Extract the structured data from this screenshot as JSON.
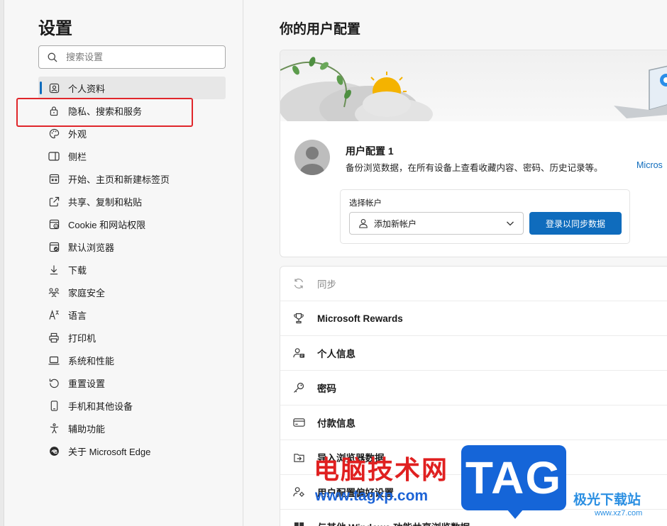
{
  "sidebar": {
    "title": "设置",
    "search_placeholder": "搜索设置",
    "items": [
      {
        "label": "个人资料",
        "icon": "profile-icon",
        "active": true
      },
      {
        "label": "隐私、搜索和服务",
        "icon": "lock-icon"
      },
      {
        "label": "外观",
        "icon": "palette-icon"
      },
      {
        "label": "侧栏",
        "icon": "sidebar-icon"
      },
      {
        "label": "开始、主页和新建标签页",
        "icon": "home-tab-icon"
      },
      {
        "label": "共享、复制和粘贴",
        "icon": "share-icon"
      },
      {
        "label": "Cookie 和网站权限",
        "icon": "cookie-icon"
      },
      {
        "label": "默认浏览器",
        "icon": "browser-icon"
      },
      {
        "label": "下载",
        "icon": "download-icon"
      },
      {
        "label": "家庭安全",
        "icon": "family-icon"
      },
      {
        "label": "语言",
        "icon": "language-icon"
      },
      {
        "label": "打印机",
        "icon": "printer-icon"
      },
      {
        "label": "系统和性能",
        "icon": "laptop-icon"
      },
      {
        "label": "重置设置",
        "icon": "reset-icon"
      },
      {
        "label": "手机和其他设备",
        "icon": "phone-icon"
      },
      {
        "label": "辅助功能",
        "icon": "accessibility-icon"
      },
      {
        "label": "关于 Microsoft Edge",
        "icon": "edge-icon"
      }
    ]
  },
  "main": {
    "title": "你的用户配置",
    "profile": {
      "name": "用户配置 1",
      "description": "备份浏览数据，在所有设备上查看收藏内容、密码、历史记录等。",
      "link": "Micros",
      "account_label": "选择帐户",
      "account_value": "添加新帐户",
      "signin_button": "登录以同步数据"
    },
    "rows": [
      {
        "label": "同步",
        "icon": "sync-icon",
        "muted": true
      },
      {
        "label": "Microsoft Rewards",
        "icon": "trophy-icon"
      },
      {
        "label": "个人信息",
        "icon": "person-card-icon"
      },
      {
        "label": "密码",
        "icon": "key-icon"
      },
      {
        "label": "付款信息",
        "icon": "card-icon"
      },
      {
        "label": "导入浏览器数据",
        "icon": "import-icon"
      },
      {
        "label": "用户配置偏好设置",
        "icon": "profile-settings-icon"
      },
      {
        "label": "与其他 Windows 功能共享浏览数据",
        "icon": "windows-icon"
      }
    ]
  },
  "watermark": {
    "cn": "电脑技术网",
    "url": "www.tagxp.com",
    "tag": "TAG",
    "site": "极光下载站",
    "site_url": "www.xz7.com"
  },
  "colors": {
    "accent": "#0f6cbd",
    "highlight": "#e0262b"
  }
}
